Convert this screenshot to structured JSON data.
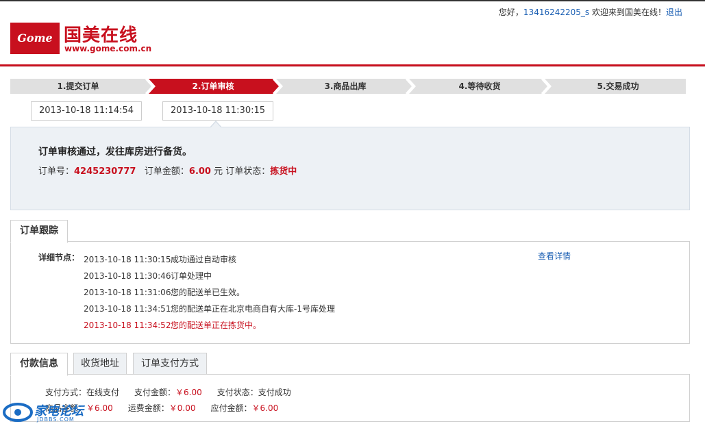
{
  "header": {
    "greeting": "您好，",
    "username": "13416242205_s",
    "welcome": " 欢迎来到国美在线！",
    "logout": "退出",
    "logo_mark": "Gome",
    "logo_name": "国美在线",
    "logo_url": "www.gome.com.cn",
    "brand_color": "#c8101e"
  },
  "steps": [
    {
      "label": "1.提交订单",
      "active": false
    },
    {
      "label": "2.订单审核",
      "active": true
    },
    {
      "label": "3.商品出库",
      "active": false
    },
    {
      "label": "4.等待收货",
      "active": false
    },
    {
      "label": "5.交易成功",
      "active": false
    }
  ],
  "step_times": [
    "2013-10-18 11:14:54",
    "2013-10-18 11:30:15"
  ],
  "status": {
    "title": "订单审核通过，发往库房进行备货。",
    "order_no_label": "订单号：",
    "order_no": "4245230777",
    "amount_label": "订单金额：",
    "amount": "6.00",
    "amount_unit": " 元 ",
    "state_label": "订单状态：",
    "state": "拣货中"
  },
  "tracking": {
    "tab": "订单跟踪",
    "label": "详细节点：",
    "detail_link": "查看详情",
    "rows": [
      {
        "time": "2013-10-18 11:30:15",
        "text": "成功通过自动审核"
      },
      {
        "time": "2013-10-18 11:30:46",
        "text": "订单处理中"
      },
      {
        "time": "2013-10-18 11:31:06",
        "text": "您的配送单已生效。"
      },
      {
        "time": "2013-10-18 11:34:51",
        "text": "您的配送单正在北京电商自有大库-1号库处理"
      },
      {
        "time": "2013-10-18 11:34:52",
        "text": "您的配送单正在拣货中。"
      }
    ]
  },
  "payment": {
    "tabs": [
      "付款信息",
      "收货地址",
      "订单支付方式"
    ],
    "method_label": "支付方式：",
    "method": "在线支付",
    "paid_label": "支付金额：",
    "paid": "￥6.00",
    "state_label": "支付状态：",
    "state": "支付成功",
    "goods_label": "商品金额：",
    "goods": "￥6.00",
    "shipping_label": "运费金额：",
    "shipping": "￥0.00",
    "due_label": "应付金额：",
    "due": "￥6.00"
  },
  "watermark": {
    "name": "家电论坛",
    "site": "JDBBS.COM"
  }
}
